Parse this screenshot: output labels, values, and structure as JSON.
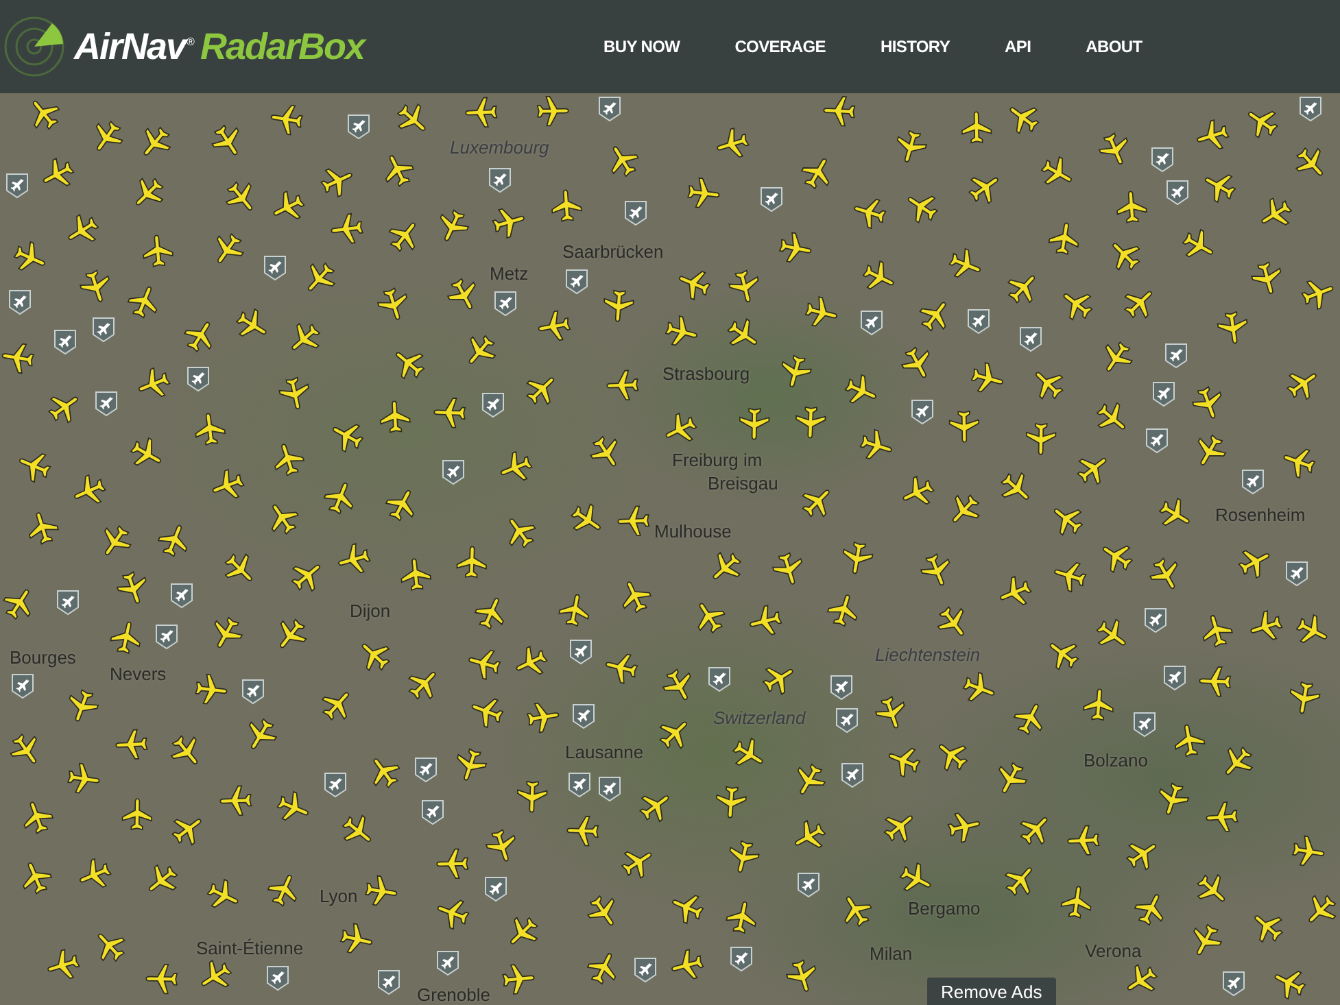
{
  "header": {
    "logo": {
      "brand": "AirNav",
      "registered": "®",
      "product": "RadarBox"
    },
    "nav": [
      {
        "label": "BUY NOW"
      },
      {
        "label": "COVERAGE"
      },
      {
        "label": "HISTORY"
      },
      {
        "label": "API"
      },
      {
        "label": "ABOUT"
      }
    ]
  },
  "map": {
    "places": [
      {
        "name": "Luxembourg",
        "kind": "region"
      },
      {
        "name": "Saarbrücken",
        "kind": "city"
      },
      {
        "name": "Metz",
        "kind": "city"
      },
      {
        "name": "Strasbourg",
        "kind": "city"
      },
      {
        "name": "Freiburg im",
        "kind": "city"
      },
      {
        "name": "Breisgau",
        "kind": "city"
      },
      {
        "name": "Mulhouse",
        "kind": "city"
      },
      {
        "name": "Rosenheim",
        "kind": "city"
      },
      {
        "name": "Dijon",
        "kind": "city"
      },
      {
        "name": "Liechtenstein",
        "kind": "region"
      },
      {
        "name": "Bourges",
        "kind": "city"
      },
      {
        "name": "Nevers",
        "kind": "city"
      },
      {
        "name": "Switzerland",
        "kind": "region"
      },
      {
        "name": "Lausanne",
        "kind": "city"
      },
      {
        "name": "Bolzano",
        "kind": "city"
      },
      {
        "name": "Lyon",
        "kind": "city"
      },
      {
        "name": "Bergamo",
        "kind": "city"
      },
      {
        "name": "Saint-Étienne",
        "kind": "city"
      },
      {
        "name": "Milan",
        "kind": "city"
      },
      {
        "name": "Verona",
        "kind": "city"
      },
      {
        "name": "Grenoble",
        "kind": "city"
      }
    ]
  },
  "remove_ads": {
    "label": "Remove Ads"
  }
}
